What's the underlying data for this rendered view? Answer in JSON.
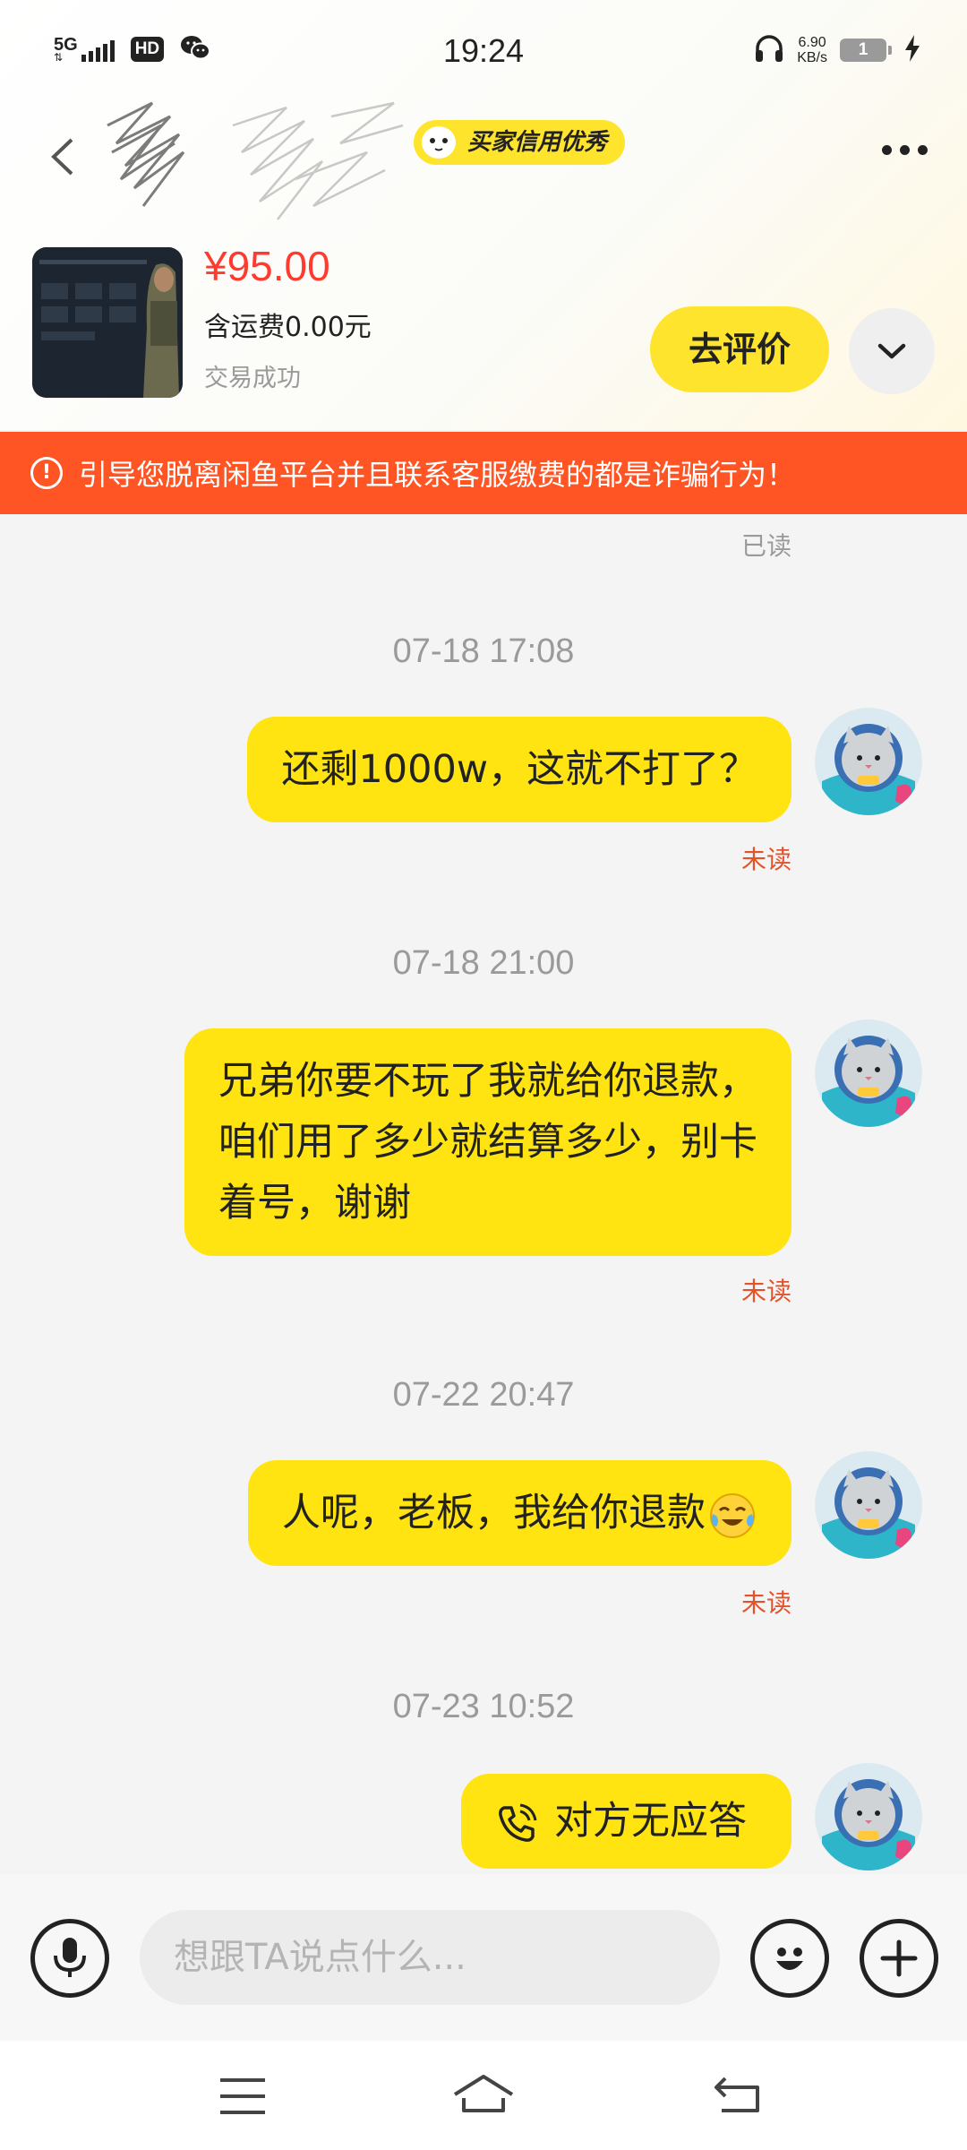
{
  "status_bar": {
    "network": "5G",
    "hd": "HD",
    "time": "19:24",
    "net_speed_value": "6.90",
    "net_speed_unit": "KB/s",
    "battery_level": "1"
  },
  "header": {
    "seller_name": "",
    "credit_badge": "买家信用优秀",
    "icons": {
      "back": "back-arrow-icon",
      "more": "more-dots-icon",
      "wechat": "wechat-icon"
    }
  },
  "product": {
    "price": "¥95.00",
    "shipping": "含运费0.00元",
    "status": "交易成功",
    "review_button": "去评价",
    "expand_icon": "chevron-down-icon"
  },
  "banner": {
    "text": "引导您脱离闲鱼平台并且联系客服缴费的都是诈骗行为！",
    "icon": "warning-circle-icon",
    "color": "#ff5525"
  },
  "chat": {
    "first_read_label": "已读",
    "messages": [
      {
        "timestamp": "07-18 17:08",
        "text": "还剩1000w，这就不打了？",
        "read": "未读"
      },
      {
        "timestamp": "07-18 21:00",
        "line1": "兄弟你要不玩了我就给你退款，",
        "line2": "咱们用了多少就结算多少，别卡",
        "line3": "着号，谢谢",
        "read": "未读"
      },
      {
        "timestamp": "07-22 20:47",
        "text": "人呢，老板，我给你退款",
        "emoji": "crying-laughing-emoji",
        "read": "未读"
      },
      {
        "timestamp": "07-23 10:52",
        "text": "对方无应答",
        "icon": "phone-call-icon"
      }
    ],
    "bubble_color": "#ffe411",
    "unread_color": "#e2532a"
  },
  "input_bar": {
    "placeholder": "想跟TA说点什么...",
    "voice_icon": "microphone-icon",
    "emoji_icon": "smiley-icon",
    "plus_icon": "plus-icon"
  },
  "system_nav": {
    "menu": "menu-icon",
    "home": "home-icon",
    "back": "back-icon"
  },
  "colors": {
    "accent": "#ffe42e",
    "price": "#ff3b2f"
  }
}
